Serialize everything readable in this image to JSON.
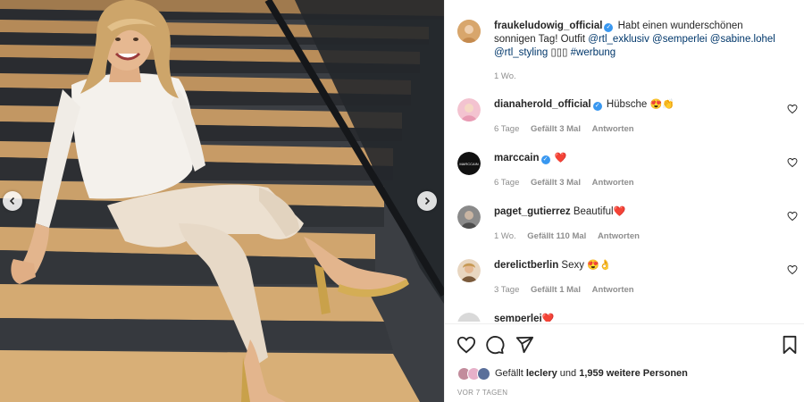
{
  "post": {
    "author": "fraukeludowig_official",
    "caption_text": "Habt einen wunderschönen sonnigen Tag! Outfit ",
    "mentions": [
      "@rtl_exklusiv",
      "@semperlei",
      "@sabine.lohel",
      "@rtl_styling"
    ],
    "caption_end_glyphs": "▯▯▯",
    "hashtag": "#werbung",
    "time": "1 Wo."
  },
  "comments": [
    {
      "user": "dianaherold_official",
      "verified": true,
      "text": "Hübsche",
      "emoji": "😍👏",
      "time": "6 Tage",
      "likes": "Gefällt 3 Mal",
      "reply": "Antworten",
      "avatar_color": "#e9a6b8"
    },
    {
      "user": "marccain",
      "verified": true,
      "text": "",
      "emoji": "❤️",
      "time": "6 Tage",
      "likes": "Gefällt 3 Mal",
      "reply": "Antworten",
      "avatar_color": "#111111",
      "avatar_text": "MARCCAIN"
    },
    {
      "user": "paget_gutierrez",
      "verified": false,
      "text": "Beautiful",
      "emoji": "❤️",
      "time": "1 Wo.",
      "likes": "Gefällt 110 Mal",
      "reply": "Antworten",
      "avatar_color": "#6b6b6b"
    },
    {
      "user": "derelictberlin",
      "verified": false,
      "text": "Sexy",
      "emoji": "😍👌",
      "time": "3 Tage",
      "likes": "Gefällt 1 Mal",
      "reply": "Antworten",
      "avatar_color": "#c8a27a"
    },
    {
      "user": "semperlei",
      "verified": false,
      "text": "",
      "emoji": "❤️",
      "time": "",
      "likes": "",
      "reply": "",
      "avatar_color": "#d9d9d9"
    }
  ],
  "likes_summary": {
    "prefix": "Gefällt ",
    "user": "leclery",
    "middle": " und ",
    "count": "1,959 weitere Personen"
  },
  "post_date": "VOR 7 TAGEN",
  "colors": {
    "like_red": "#ed4956",
    "verified_blue": "#3897f0",
    "link_blue": "#00376b"
  },
  "icons": [
    "heart-icon",
    "comment-icon",
    "share-icon",
    "bookmark-icon",
    "chevron-left-icon",
    "chevron-right-icon"
  ]
}
